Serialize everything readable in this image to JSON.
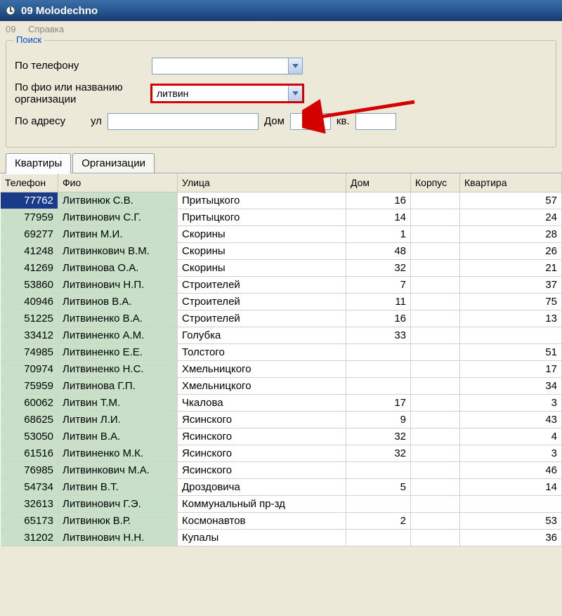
{
  "window": {
    "title": "09 Molodechno"
  },
  "menu": {
    "item1": "09",
    "item2": "Справка"
  },
  "search": {
    "legend": "Поиск",
    "by_phone_label": "По телефону",
    "by_phone_value": "",
    "by_name_label": "По фио или названию организации",
    "by_name_value": "литвин",
    "by_addr_label": "По адресу",
    "street_prefix": "ул",
    "street_value": "",
    "house_label": "Дом",
    "house_value": "",
    "flat_label": "кв.",
    "flat_value": ""
  },
  "tabs": {
    "apartments": "Квартиры",
    "organizations": "Организации"
  },
  "columns": {
    "tel": "Телефон",
    "fio": "Фио",
    "street": "Улица",
    "house": "Дом",
    "korpus": "Корпус",
    "flat": "Квартира"
  },
  "rows": [
    {
      "tel": "77762",
      "fio": "Литвинюк С.В.",
      "street": "Притыцкого",
      "house": "16",
      "korpus": "",
      "flat": "57",
      "selected": true
    },
    {
      "tel": "77959",
      "fio": "Литвинович С.Г.",
      "street": "Притыцкого",
      "house": "14",
      "korpus": "",
      "flat": "24"
    },
    {
      "tel": "69277",
      "fio": "Литвин М.И.",
      "street": "Скорины",
      "house": "1",
      "korpus": "",
      "flat": "28"
    },
    {
      "tel": "41248",
      "fio": "Литвинкович В.М.",
      "street": "Скорины",
      "house": "48",
      "korpus": "",
      "flat": "26"
    },
    {
      "tel": "41269",
      "fio": "Литвинова О.А.",
      "street": "Скорины",
      "house": "32",
      "korpus": "",
      "flat": "21"
    },
    {
      "tel": "53860",
      "fio": "Литвинович Н.П.",
      "street": "Строителей",
      "house": "7",
      "korpus": "",
      "flat": "37"
    },
    {
      "tel": "40946",
      "fio": "Литвинов В.А.",
      "street": "Строителей",
      "house": "11",
      "korpus": "",
      "flat": "75"
    },
    {
      "tel": "51225",
      "fio": "Литвиненко В.А.",
      "street": "Строителей",
      "house": "16",
      "korpus": "",
      "flat": "13"
    },
    {
      "tel": "33412",
      "fio": "Литвиненко А.М.",
      "street": "Голубка",
      "house": "33",
      "korpus": "",
      "flat": ""
    },
    {
      "tel": "74985",
      "fio": "Литвиненко Е.Е.",
      "street": "Толстого",
      "house": "",
      "korpus": "",
      "flat": "51"
    },
    {
      "tel": "70974",
      "fio": "Литвиненко Н.С.",
      "street": "Хмельницкого",
      "house": "",
      "korpus": "",
      "flat": "17"
    },
    {
      "tel": "75959",
      "fio": "Литвинова Г.П.",
      "street": "Хмельницкого",
      "house": "",
      "korpus": "",
      "flat": "34"
    },
    {
      "tel": "60062",
      "fio": "Литвин Т.М.",
      "street": "Чкалова",
      "house": "17",
      "korpus": "",
      "flat": "3"
    },
    {
      "tel": "68625",
      "fio": "Литвин Л.И.",
      "street": "Ясинского",
      "house": "9",
      "korpus": "",
      "flat": "43"
    },
    {
      "tel": "53050",
      "fio": "Литвин В.А.",
      "street": "Ясинского",
      "house": "32",
      "korpus": "",
      "flat": "4"
    },
    {
      "tel": "61516",
      "fio": "Литвиненко М.К.",
      "street": "Ясинского",
      "house": "32",
      "korpus": "",
      "flat": "3"
    },
    {
      "tel": "76985",
      "fio": "Литвинкович М.А.",
      "street": "Ясинского",
      "house": "",
      "korpus": "",
      "flat": "46"
    },
    {
      "tel": "54734",
      "fio": "Литвин В.Т.",
      "street": "Дроздовича",
      "house": "5",
      "korpus": "",
      "flat": "14"
    },
    {
      "tel": "32613",
      "fio": "Литвинович Г.Э.",
      "street": "Коммунальный пр-зд",
      "house": "",
      "korpus": "",
      "flat": ""
    },
    {
      "tel": "65173",
      "fio": "Литвинюк В.Р.",
      "street": "Космонавтов",
      "house": "2",
      "korpus": "",
      "flat": "53"
    },
    {
      "tel": "31202",
      "fio": "Литвинович Н.Н.",
      "street": "Купалы",
      "house": "",
      "korpus": "",
      "flat": "36"
    }
  ]
}
